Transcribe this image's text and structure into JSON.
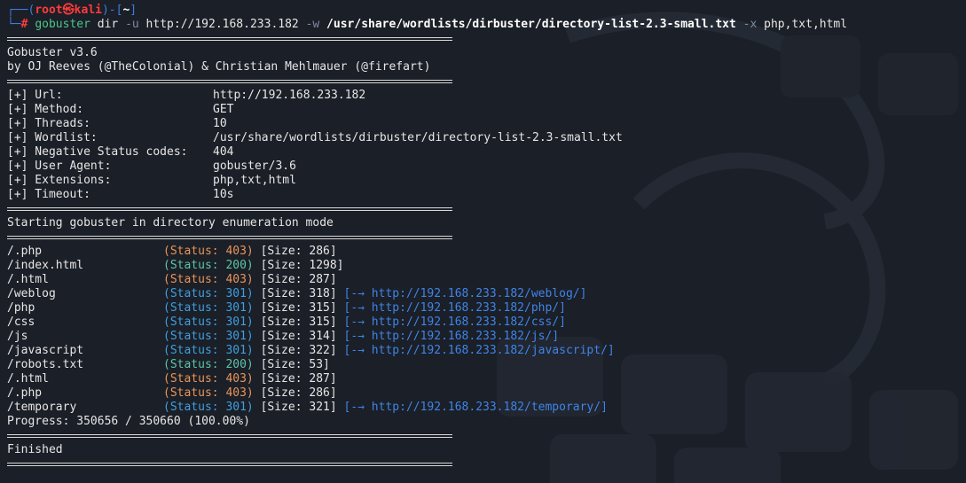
{
  "prompt": {
    "top_prefix": "┌──(",
    "user": "root",
    "at": "㉿",
    "host": "kali",
    "mid": ")-[",
    "dir": "~",
    "close": "]",
    "bottom_prefix": "└─",
    "hash": "#",
    "command": "gobuster",
    "arg1": " dir ",
    "flag_u": "-u",
    "url": " http://192.168.233.182 ",
    "flag_w": "-w",
    "wordlist": " /usr/share/wordlists/dirbuster/directory-list-2.3-small.txt ",
    "flag_x": "-x",
    "exts": " php,txt,html"
  },
  "banner": {
    "version": "Gobuster v3.6",
    "authors": "by OJ Reeves (@TheColonial) & Christian Mehlmauer (@firefart)"
  },
  "config": [
    {
      "key": "[+] Url:",
      "value": "http://192.168.233.182"
    },
    {
      "key": "[+] Method:",
      "value": "GET"
    },
    {
      "key": "[+] Threads:",
      "value": "10"
    },
    {
      "key": "[+] Wordlist:",
      "value": "/usr/share/wordlists/dirbuster/directory-list-2.3-small.txt"
    },
    {
      "key": "[+] Negative Status codes:",
      "value": "404"
    },
    {
      "key": "[+] User Agent:",
      "value": "gobuster/3.6"
    },
    {
      "key": "[+] Extensions:",
      "value": "php,txt,html"
    },
    {
      "key": "[+] Timeout:",
      "value": "10s"
    }
  ],
  "start_msg": "Starting gobuster in directory enumeration mode",
  "results": [
    {
      "path": "/.php",
      "status": "(Status: 403)",
      "code": "403",
      "size": "[Size: 286]",
      "redirect": ""
    },
    {
      "path": "/index.html",
      "status": "(Status: 200)",
      "code": "200",
      "size": "[Size: 1298]",
      "redirect": ""
    },
    {
      "path": "/.html",
      "status": "(Status: 403)",
      "code": "403",
      "size": "[Size: 287]",
      "redirect": ""
    },
    {
      "path": "/weblog",
      "status": "(Status: 301)",
      "code": "301",
      "size": "[Size: 318]",
      "redirect": "[-→ http://192.168.233.182/weblog/]"
    },
    {
      "path": "/php",
      "status": "(Status: 301)",
      "code": "301",
      "size": "[Size: 315]",
      "redirect": "[-→ http://192.168.233.182/php/]"
    },
    {
      "path": "/css",
      "status": "(Status: 301)",
      "code": "301",
      "size": "[Size: 315]",
      "redirect": "[-→ http://192.168.233.182/css/]"
    },
    {
      "path": "/js",
      "status": "(Status: 301)",
      "code": "301",
      "size": "[Size: 314]",
      "redirect": "[-→ http://192.168.233.182/js/]"
    },
    {
      "path": "/javascript",
      "status": "(Status: 301)",
      "code": "301",
      "size": "[Size: 322]",
      "redirect": "[-→ http://192.168.233.182/javascript/]"
    },
    {
      "path": "/robots.txt",
      "status": "(Status: 200)",
      "code": "200",
      "size": "[Size: 53]",
      "redirect": ""
    },
    {
      "path": "/.html",
      "status": "(Status: 403)",
      "code": "403",
      "size": "[Size: 287]",
      "redirect": ""
    },
    {
      "path": "/.php",
      "status": "(Status: 403)",
      "code": "403",
      "size": "[Size: 286]",
      "redirect": ""
    },
    {
      "path": "/temporary",
      "status": "(Status: 301)",
      "code": "301",
      "size": "[Size: 321]",
      "redirect": "[-→ http://192.168.233.182/temporary/]"
    }
  ],
  "progress": "Progress: 350656 / 350660 (100.00%)",
  "finished": "Finished",
  "colors": {
    "background": "#1b1f27",
    "prompt_blue": "#3f7be0",
    "root_red": "#ff3b3b",
    "status_403": "#e8955a",
    "status_200": "#5cc6a8",
    "status_301": "#3f9fe0"
  }
}
